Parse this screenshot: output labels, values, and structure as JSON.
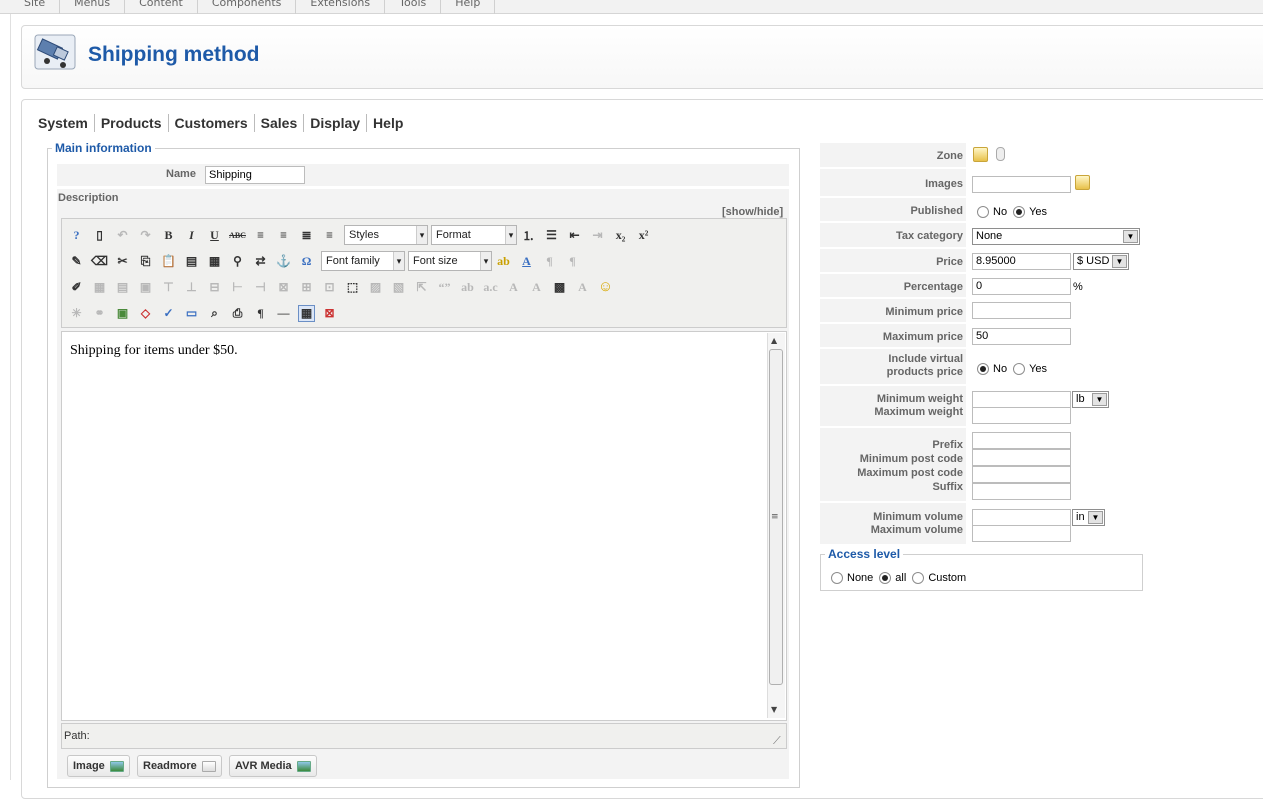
{
  "top_menu": [
    "Site",
    "Menus",
    "Content",
    "Components",
    "Extensions",
    "Tools",
    "Help"
  ],
  "header": {
    "title": "Shipping method",
    "icon": "truck-icon"
  },
  "sub_nav": [
    "System",
    "Products",
    "Customers",
    "Sales",
    "Display",
    "Help"
  ],
  "main_info": {
    "legend": "Main information",
    "name_label": "Name",
    "name_value": "Shipping",
    "description_label": "Description",
    "show_hide": "[show/hide]",
    "styles_select": "Styles",
    "format_select": "Format",
    "font_family_select": "Font family",
    "font_size_select": "Font size",
    "editor_content": "Shipping for items under $50.",
    "path_label": "Path:",
    "buttons": [
      "Image",
      "Readmore",
      "AVR Media"
    ]
  },
  "right": {
    "zone_label": "Zone",
    "images_label": "Images",
    "images_value": "",
    "published_label": "Published",
    "published_options": [
      "No",
      "Yes"
    ],
    "published_selected": "Yes",
    "tax_category_label": "Tax category",
    "tax_category_value": "None",
    "price_label": "Price",
    "price_value": "8.95000",
    "currency_value": "$ USD",
    "percentage_label": "Percentage",
    "percentage_value": "0",
    "percent_sign": "%",
    "min_price_label": "Minimum price",
    "min_price_value": "",
    "max_price_label": "Maximum price",
    "max_price_value": "50",
    "include_virtual_label_1": "Include virtual",
    "include_virtual_label_2": "products price",
    "include_virtual_options": [
      "No",
      "Yes"
    ],
    "include_virtual_selected": "No",
    "min_weight_label": "Minimum weight",
    "max_weight_label": "Maximum weight",
    "weight_unit": "lb",
    "prefix_label": "Prefix",
    "min_postcode_label": "Minimum post code",
    "max_postcode_label": "Maximum post code",
    "suffix_label": "Suffix",
    "min_volume_label": "Minimum volume",
    "max_volume_label": "Maximum volume",
    "volume_unit": "in"
  },
  "access_level": {
    "legend": "Access level",
    "options": [
      "None",
      "all",
      "Custom"
    ],
    "selected": "all"
  }
}
